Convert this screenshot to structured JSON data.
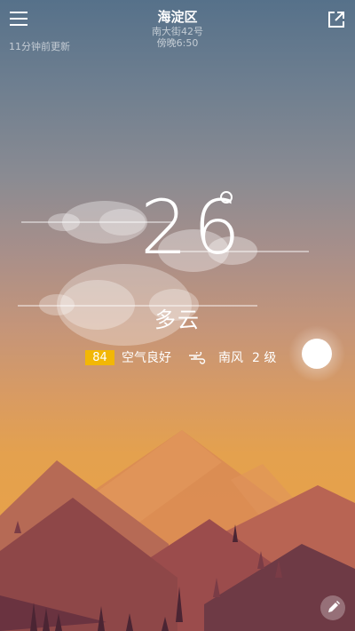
{
  "header": {
    "updated": "11分钟前更新",
    "city": "海淀区",
    "street": "南大街42号",
    "time": "傍晚6:50"
  },
  "weather": {
    "temperature": "26",
    "condition": "多云"
  },
  "air": {
    "aqi": "84",
    "quality": "空气良好"
  },
  "wind": {
    "direction": "南风",
    "level": "2 级"
  },
  "icons": {
    "menu": "menu-icon",
    "share": "share-icon",
    "wind": "wind-icon",
    "edit": "edit-icon"
  },
  "colors": {
    "aqi_badge": "#f2b705",
    "sky_top": "#56718a",
    "sky_bottom": "#eaa244"
  }
}
